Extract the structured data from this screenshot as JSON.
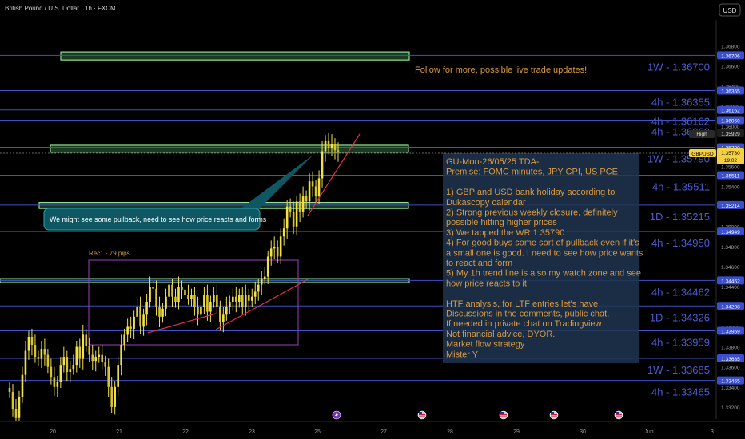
{
  "header": {
    "symbol_title": "British Pound / U.S. Dollar · 1h · FXCM",
    "currency_button": "USD"
  },
  "colors": {
    "background": "#000000",
    "level_line": "#3f51c8",
    "level_label": "#4c5cd8",
    "zone_fill": "#2f6b3a",
    "zone_border": "#8fe08f",
    "candle_up": "#f0e04a",
    "candle_down": "#f0e04a",
    "trendline": "#e0304a",
    "price_tag": "#f5d142",
    "rect_border": "#9b3fbf",
    "annotation_bg": "#1f3550",
    "follow_text": "#d89a40",
    "callout_bg": "#0e5763"
  },
  "chart_data": {
    "type": "candlestick",
    "symbol": "GBPUSD",
    "timeframe": "1h",
    "ylim": [
      1.3308,
      1.369
    ],
    "x_ticks": [
      "20",
      "21",
      "22",
      "23",
      "25",
      "27",
      "28",
      "29",
      "30",
      "Jun",
      "3"
    ],
    "y_ticks": [
      "1.36800",
      "1.36600",
      "1.36400",
      "1.36200",
      "1.36000",
      "1.35800",
      "1.35600",
      "1.35400",
      "1.35200",
      "1.35000",
      "1.34800",
      "1.34600",
      "1.34400",
      "1.34200",
      "1.34000",
      "1.33800",
      "1.33600",
      "1.33400",
      "1.33200"
    ],
    "levels": [
      {
        "label": "1W - 1.36700",
        "tag": "1.36706",
        "price": 1.36706
      },
      {
        "label": "4h - 1.36355",
        "tag": "1.36355",
        "price": 1.36355
      },
      {
        "label": "4h - 1.36162",
        "tag": "1.36162",
        "price": 1.36162
      },
      {
        "label": "4h - 1.36060",
        "tag": "1.36060",
        "price": 1.3606
      },
      {
        "label": "1W - 1.35790",
        "tag": "1.35790",
        "price": 1.3579
      },
      {
        "label": "4h - 1.35511",
        "tag": "1.35511",
        "price": 1.35511
      },
      {
        "label": "1D - 1.35215",
        "tag": "1.35214",
        "price": 1.35214
      },
      {
        "label": "4h - 1.34950",
        "tag": "1.34949",
        "price": 1.34949
      },
      {
        "label": "4h - 1.34462",
        "tag": "1.34462",
        "price": 1.34462
      },
      {
        "label": "1D - 1.34326",
        "tag": "1.34208",
        "price": 1.34208
      },
      {
        "label": "4h - 1.33959",
        "tag": "1.33959",
        "price": 1.33959
      },
      {
        "label": "1W - 1.33685",
        "tag": "1.33685",
        "price": 1.33685
      },
      {
        "label": "4h - 1.33465",
        "tag": "1.33465",
        "price": 1.33465
      }
    ],
    "high_tag": {
      "label": "High",
      "value": "1.35929",
      "price": 1.35929
    },
    "current_price": {
      "symbol": "GBPUSD",
      "value": "1.35730",
      "countdown": "19:02",
      "price": 1.3573
    },
    "zones": [
      {
        "name": "weekly-zone-top",
        "price_top": 1.3674,
        "price_bottom": 1.3666
      },
      {
        "name": "weekly-zone-mid",
        "price_top": 1.3581,
        "price_bottom": 1.3574
      },
      {
        "name": "daily-zone",
        "price_top": 1.3524,
        "price_bottom": 1.3518
      },
      {
        "name": "h4-zone",
        "price_top": 1.3448,
        "price_bottom": 1.3444
      }
    ],
    "closes": [
      1.3335,
      1.3318,
      1.3309,
      1.333,
      1.3352,
      1.3376,
      1.339,
      1.3382,
      1.337,
      1.3368,
      1.3378,
      1.3372,
      1.336,
      1.335,
      1.334,
      1.3345,
      1.3362,
      1.337,
      1.3355,
      1.3358,
      1.3362,
      1.338,
      1.3368,
      1.3392,
      1.3381,
      1.3372,
      1.3366,
      1.337,
      1.3372,
      1.3365,
      1.336,
      1.334,
      1.332,
      1.334,
      1.3362,
      1.3382,
      1.3392,
      1.34,
      1.3398,
      1.341,
      1.342,
      1.34,
      1.3412,
      1.3425,
      1.344,
      1.3438,
      1.342,
      1.341,
      1.3418,
      1.343,
      1.3442,
      1.343,
      1.3425,
      1.344,
      1.3437,
      1.3432,
      1.3428,
      1.3432,
      1.342,
      1.3412,
      1.342,
      1.3432,
      1.3415,
      1.3425,
      1.3432,
      1.342,
      1.3405,
      1.3412,
      1.342,
      1.3425,
      1.343,
      1.3425,
      1.3432,
      1.342,
      1.3432,
      1.3426,
      1.343,
      1.3435,
      1.3442,
      1.3448,
      1.345,
      1.347,
      1.3478,
      1.348,
      1.347,
      1.349,
      1.3498,
      1.352,
      1.3515,
      1.35,
      1.3525,
      1.3515,
      1.353,
      1.3525,
      1.3545,
      1.354,
      1.353,
      1.3548,
      1.3575,
      1.3585,
      1.3578,
      1.3582,
      1.3576,
      1.3575
    ]
  },
  "annotations": {
    "follow": "Follow for more, possible live trade updates!",
    "callout": "We might see some pullback, need to see how price reacts and forms",
    "rect_label": "Rec1 - 79 pips",
    "analysis_lines": [
      "GU-Mon-26/05/25 TDA-",
      "Premise: FOMC minutes, JPY CPI, US PCE",
      "",
      "1) GBP and USD bank holiday according to",
      "Dukascopy calendar",
      "2) Strong previous weekly closure, definitely",
      "possible hitting higher prices",
      "3) We tapped the WR 1.35790",
      "4) For good buys some sort of pullback even if it's",
      "a small one is good. I need to see how price wants",
      "to react and form",
      "5) My 1h trend line is also my watch zone and see",
      "how price reacts to it",
      "",
      "HTF analysis, for LTF entries let's have",
      "Discussions in the comments, public chat,",
      "If needed in private chat on Tradingview",
      "Not financial advice, DYOR.",
      "Market flow strategy",
      "Mister Y"
    ]
  }
}
